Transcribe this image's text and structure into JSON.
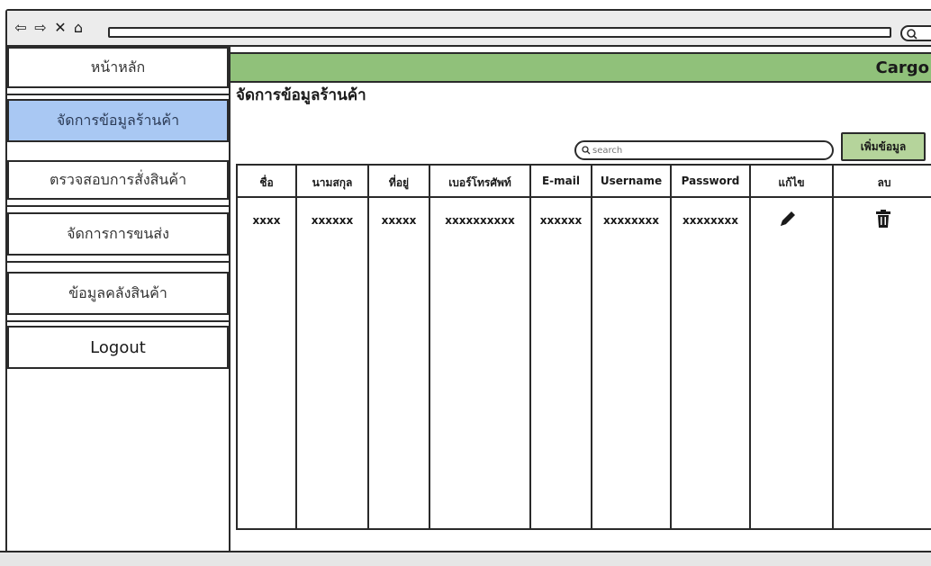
{
  "app": {
    "brand": "Cargo"
  },
  "sidebar": {
    "items": [
      {
        "label": "หน้าหลัก"
      },
      {
        "label": "จัดการข้อมูลร้านค้า"
      },
      {
        "label": "ตรวจสอบการสั่งสินค้า"
      },
      {
        "label": "จัดการการขนส่ง"
      },
      {
        "label": "ข้อมูลคลังสินค้า"
      },
      {
        "label": "Logout"
      }
    ]
  },
  "main": {
    "title": "จัดการข้อมูลร้านค้า",
    "search": {
      "placeholder": "search"
    },
    "add_label": "เพิ่มข้อมูล"
  },
  "table": {
    "columns": [
      "ชื่อ",
      "นามสกุล",
      "ที่อยู่",
      "เบอร์โทรศัพท์",
      "E-mail",
      "Username",
      "Password",
      "แก้ไข",
      "ลบ"
    ],
    "rows": [
      [
        "xxxx",
        "xxxxxx",
        "xxxxx",
        "xxxxxxxxxx",
        "xxxxxx",
        "xxxxxxxx",
        "xxxxxxxx"
      ]
    ]
  },
  "colors": {
    "accent_green": "#90c17a",
    "active_blue": "#a9c8f3",
    "button_green": "#b5d49b"
  }
}
